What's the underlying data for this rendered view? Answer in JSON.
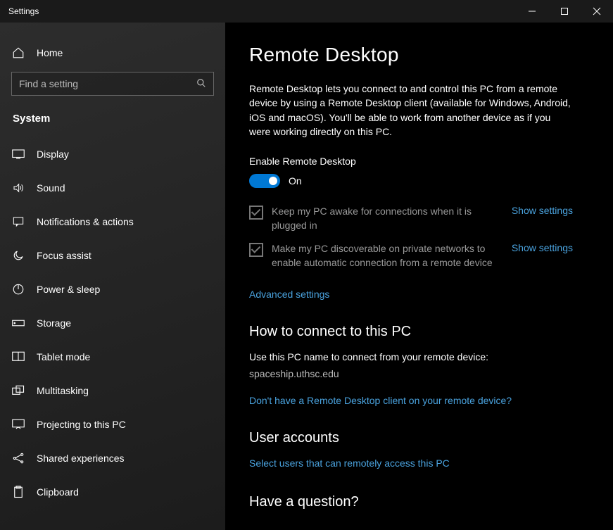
{
  "titlebar": {
    "title": "Settings"
  },
  "sidebar": {
    "home_label": "Home",
    "search_placeholder": "Find a setting",
    "group_title": "System",
    "items": [
      {
        "label": "Display"
      },
      {
        "label": "Sound"
      },
      {
        "label": "Notifications & actions"
      },
      {
        "label": "Focus assist"
      },
      {
        "label": "Power & sleep"
      },
      {
        "label": "Storage"
      },
      {
        "label": "Tablet mode"
      },
      {
        "label": "Multitasking"
      },
      {
        "label": "Projecting to this PC"
      },
      {
        "label": "Shared experiences"
      },
      {
        "label": "Clipboard"
      }
    ]
  },
  "main": {
    "title": "Remote Desktop",
    "description": "Remote Desktop lets you connect to and control this PC from a remote device by using a Remote Desktop client (available for Windows, Android, iOS and macOS). You'll be able to work from another device as if you were working directly on this PC.",
    "enable_label": "Enable Remote Desktop",
    "toggle_state": "On",
    "check1": "Keep my PC awake for connections when it is plugged in",
    "check2": "Make my PC discoverable on private networks to enable automatic connection from a remote device",
    "show_settings": "Show settings",
    "advanced": "Advanced settings",
    "howto_title": "How to connect to this PC",
    "howto_desc": "Use this PC name to connect from your remote device:",
    "pcname": "spaceship.uthsc.edu",
    "client_link": "Don't have a Remote Desktop client on your remote device?",
    "accounts_title": "User accounts",
    "accounts_link": "Select users that can remotely access this PC",
    "cutoff_heading": "Have a question?"
  }
}
